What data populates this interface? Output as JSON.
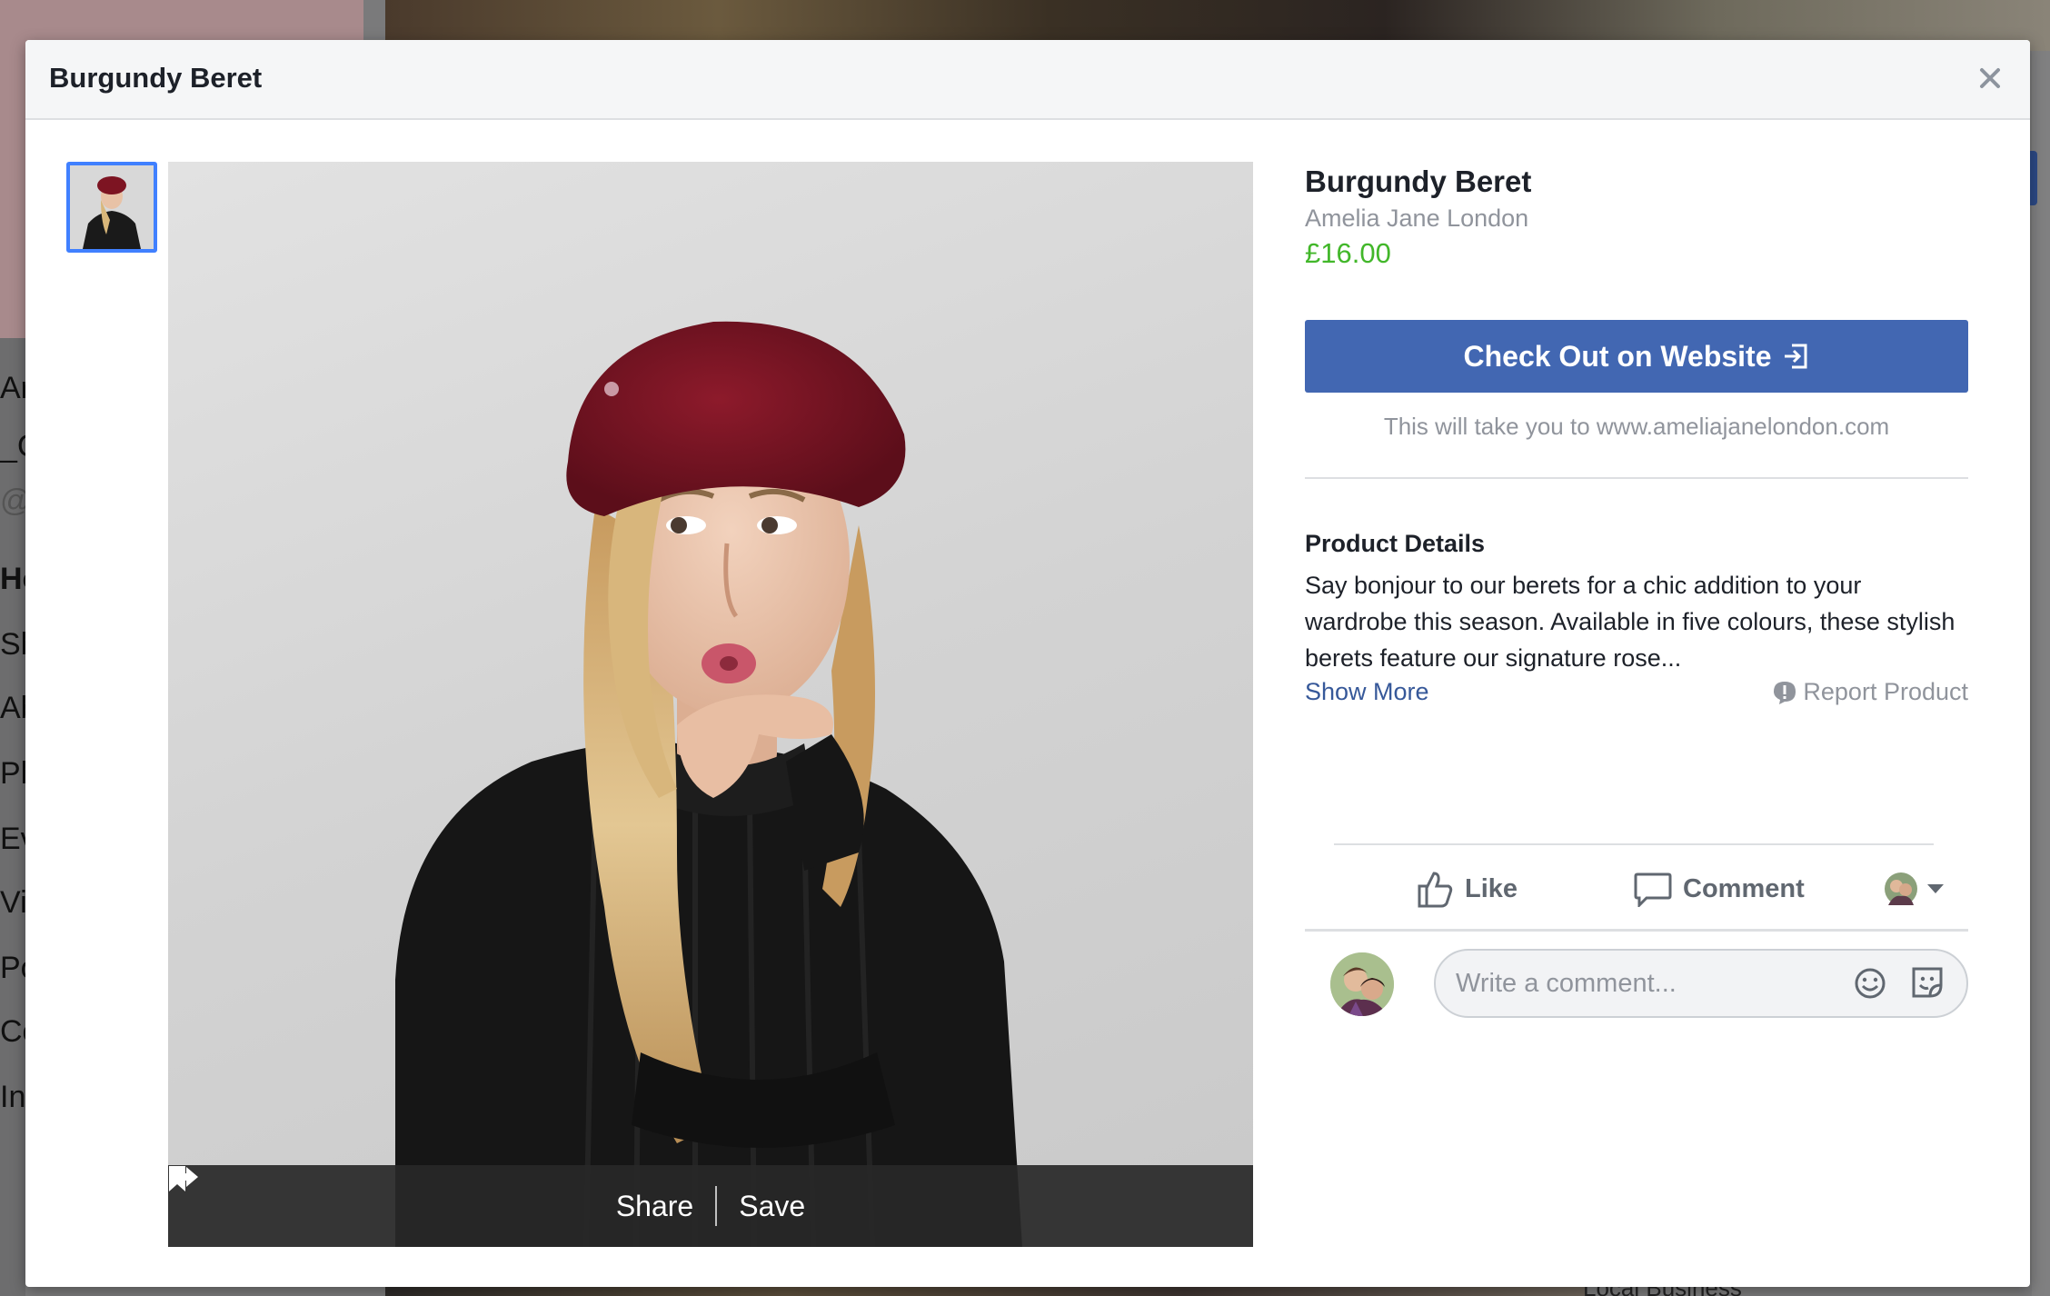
{
  "background_page": {
    "side_letters": [
      "Ar",
      "_C",
      "@a",
      "Ho",
      "Sh",
      "Ab",
      "Ph",
      "Ev",
      "Vi",
      "Po",
      "Co",
      "In"
    ],
    "bottom_text": "Local Business"
  },
  "modal": {
    "title": "Burgundy Beret",
    "close_icon": "close-icon"
  },
  "product": {
    "title": "Burgundy Beret",
    "seller": "Amelia Jane London",
    "price": "£16.00",
    "checkout_label": "Check Out on Website",
    "take_you_text": "This will take you to www.ameliajanelondon.com",
    "details_heading": "Product Details",
    "details_text": "Say bonjour to our berets for a chic addition to your wardrobe this season. Available in five colours, these stylish berets feature our signature rose...",
    "show_more": "Show More",
    "report": "Report Product"
  },
  "photo_bar": {
    "share": "Share",
    "save": "Save"
  },
  "actions": {
    "like": "Like",
    "comment": "Comment"
  },
  "comment_box": {
    "placeholder": "Write a comment..."
  },
  "colors": {
    "accent": "#4267b2",
    "price": "#42b72a",
    "link": "#365899",
    "muted": "#90949c"
  }
}
